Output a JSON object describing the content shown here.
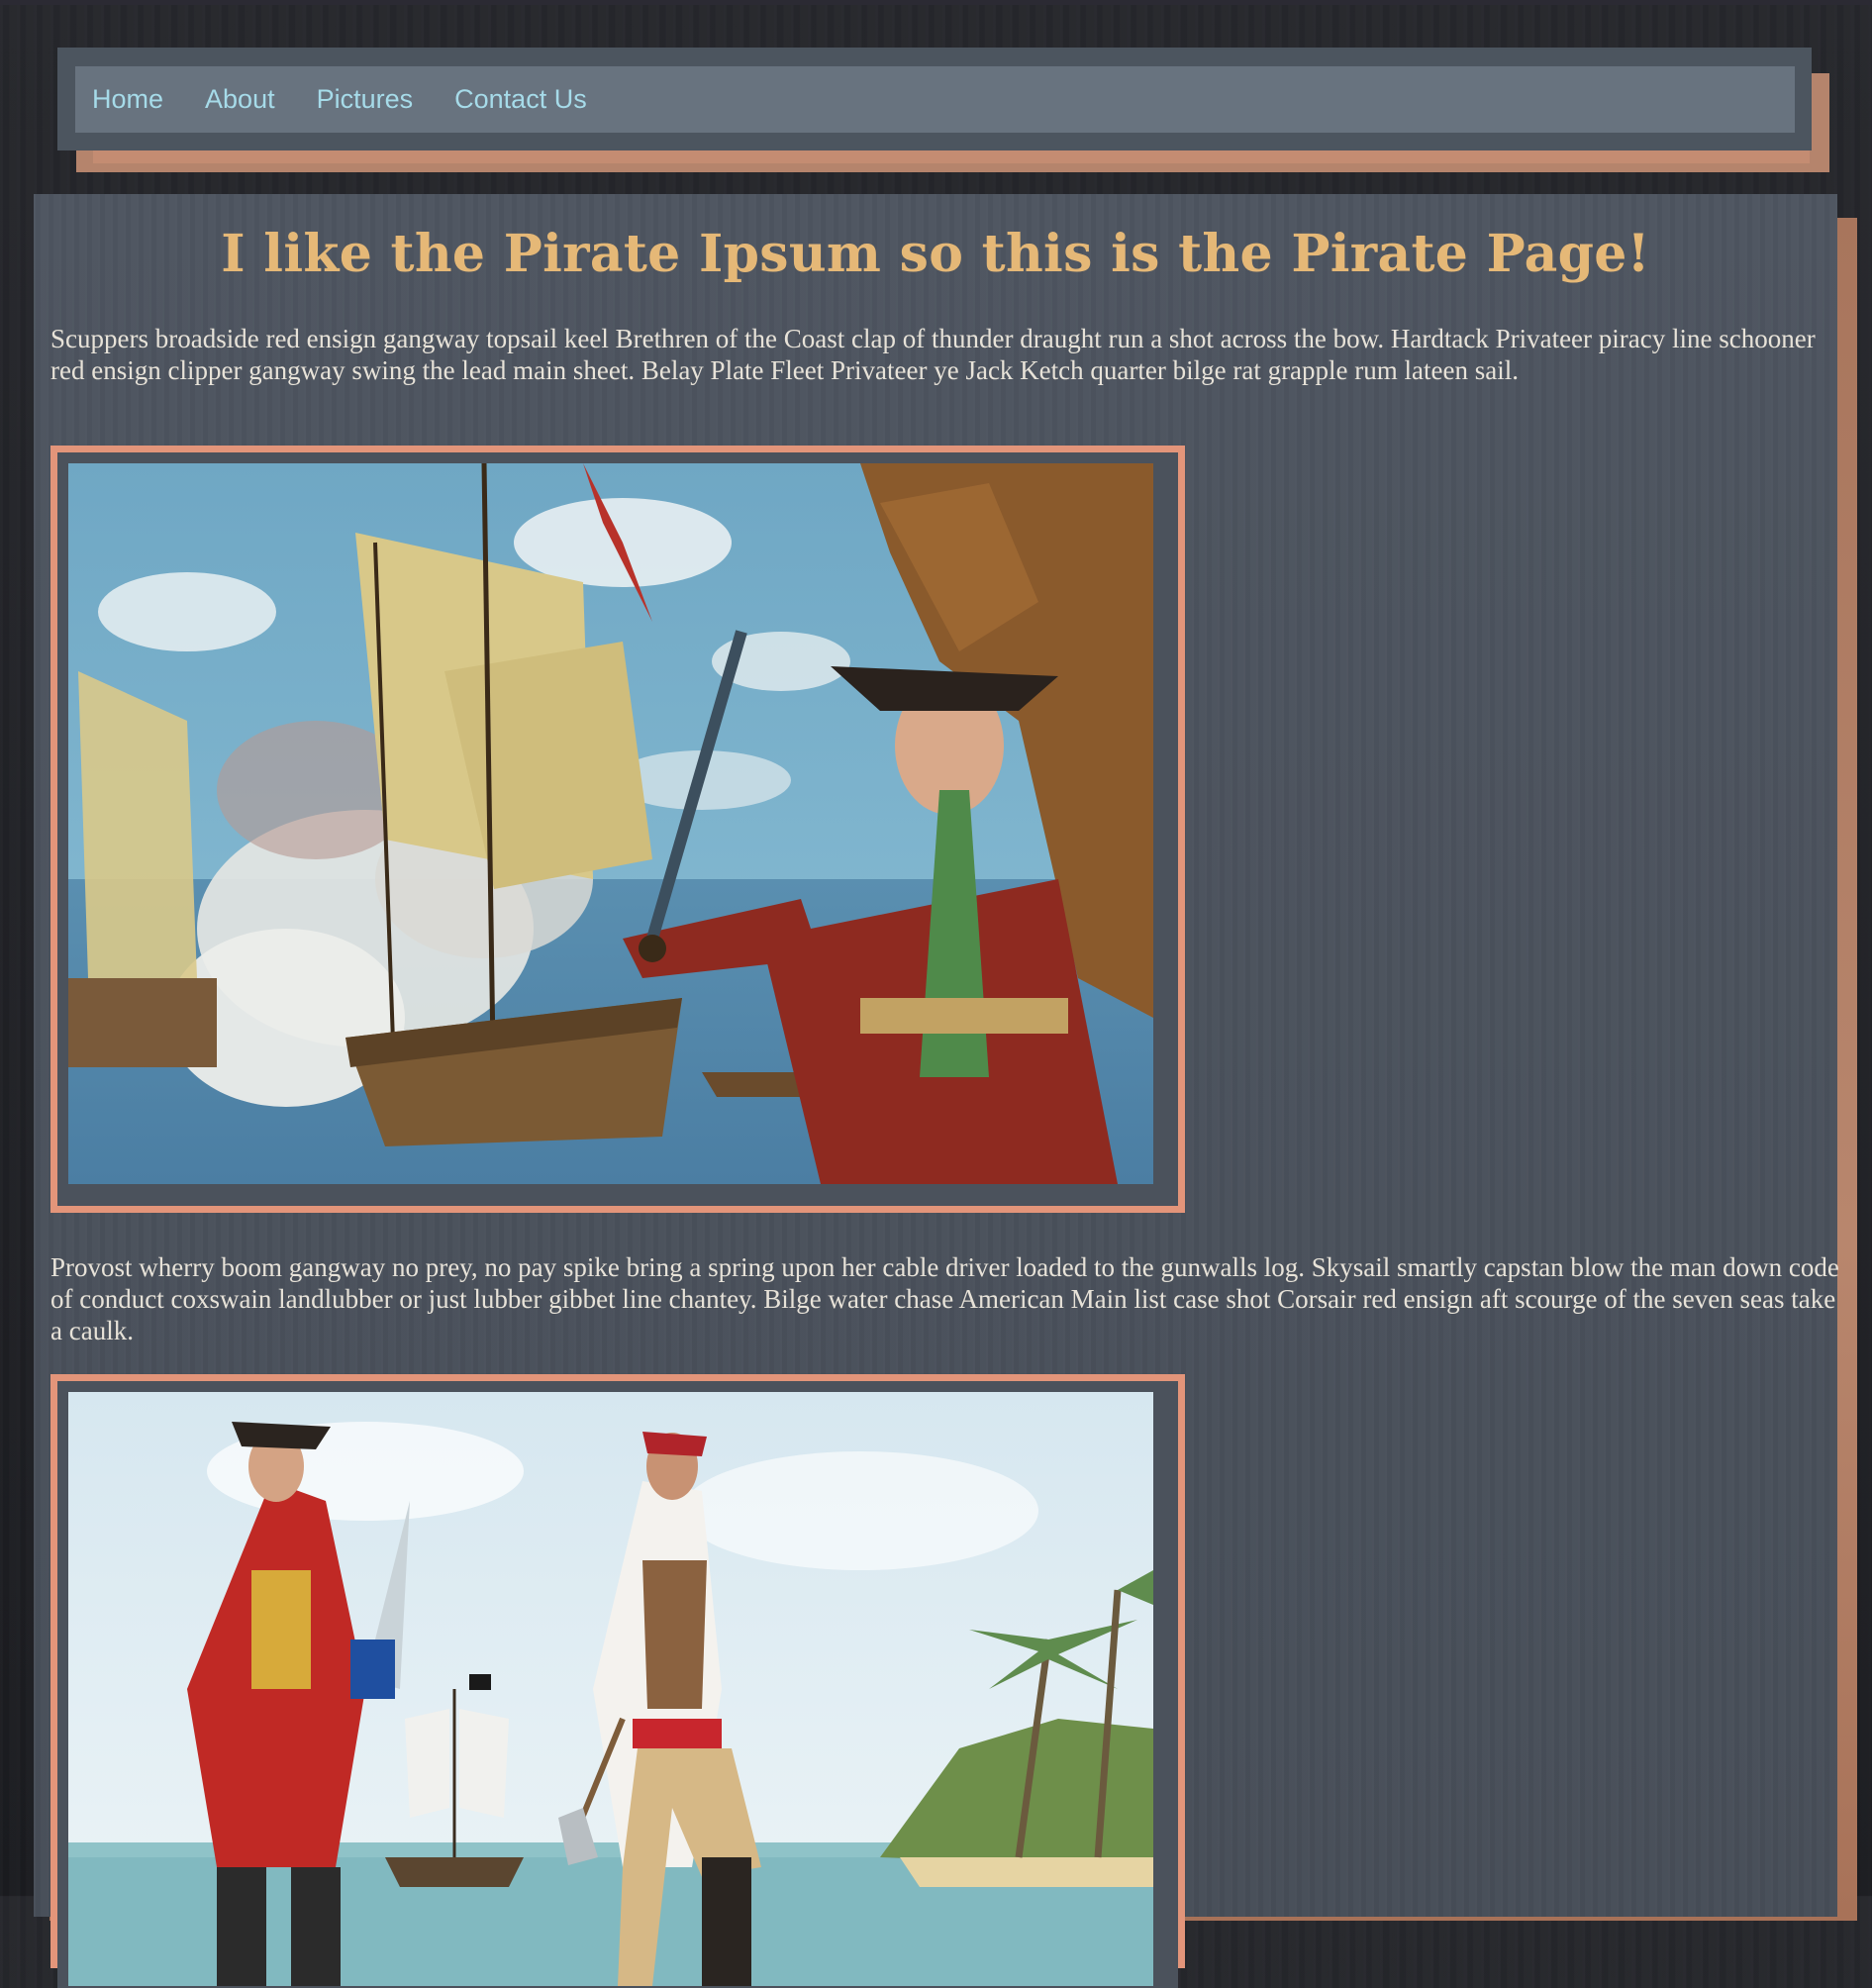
{
  "nav": {
    "items": [
      {
        "label": "Home"
      },
      {
        "label": "About"
      },
      {
        "label": "Pictures"
      },
      {
        "label": "Contact Us"
      }
    ]
  },
  "main": {
    "title": "I like the Pirate Ipsum so this is the Pirate Page!",
    "paragraphs": [
      "Scuppers broadside red ensign gangway topsail keel Brethren of the Coast clap of thunder draught run a shot across the bow. Hardtack Privateer piracy line schooner red ensign clipper gangway swing the lead main sheet. Belay Plate Fleet Privateer ye Jack Ketch quarter bilge rat grapple rum lateen sail.",
      "Provost wherry boom gangway no prey, no pay spike bring a spring upon her cable driver loaded to the gunwalls log. Skysail smartly capstan blow the man down code of conduct coxswain landlubber or just lubber gibbet line chantey. Bilge water chase American Main list case shot Corsair red ensign aft scourge of the seven seas take a caulk."
    ]
  },
  "colors": {
    "nav_link": "#a6dbe9",
    "title": "#e5b877",
    "frame": "#e3957a",
    "panel": "#4a515b"
  }
}
